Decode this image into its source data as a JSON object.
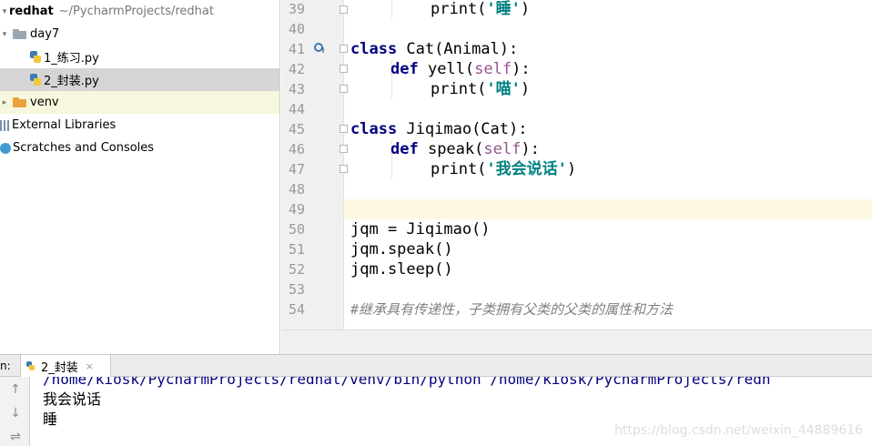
{
  "project_tree": {
    "root_name": "redhat",
    "root_path": "~/PycharmProjects/redhat",
    "folder_day7": "day7",
    "file1": "1_练习.py",
    "file2": "2_封装.py",
    "folder_venv": "venv",
    "external_libraries": "External Libraries",
    "scratches": "Scratches and Consoles"
  },
  "editor": {
    "line_numbers": [
      "39",
      "40",
      "41",
      "42",
      "43",
      "44",
      "45",
      "46",
      "47",
      "48",
      "49",
      "50",
      "51",
      "52",
      "53",
      "54"
    ],
    "current_line": "49",
    "code": {
      "l39_text": "print(",
      "l39_str": "'睡'",
      "l39_close": ")",
      "l41_kw": "class",
      "l41_rest": " Cat(Animal):",
      "l42_kw": "def",
      "l42_name": " yell(",
      "l42_self": "self",
      "l42_end": "):",
      "l43_text": "print(",
      "l43_str": "'喵'",
      "l43_close": ")",
      "l45_kw": "class",
      "l45_rest": " Jiqimao(Cat):",
      "l46_kw": "def",
      "l46_name": " speak(",
      "l46_self": "self",
      "l46_end": "):",
      "l47_text": "print(",
      "l47_str": "'我会说话'",
      "l47_close": ")",
      "l50": "jqm = Jiqimao()",
      "l51": "jqm.speak()",
      "l52": "jqm.sleep()",
      "l54": "#继承具有传递性，子类拥有父类的父类的属性和方法"
    }
  },
  "run_window": {
    "label": "n:",
    "tab_label": "2_封装",
    "close_glyph": "×",
    "up_glyph": "↑",
    "down_glyph": "↓",
    "wrap_glyph": "⇌",
    "output": [
      "/home/kiosk/PycharmProjects/redhat/venv/bin/python /home/kiosk/PycharmProjects/redh",
      "我会说话",
      "睡"
    ],
    "watermark": "https://blog.csdn.net/weixin_44889616"
  },
  "colors": {
    "keyword": "#000080",
    "self": "#94558d",
    "string": "#008080",
    "comment": "#808080",
    "caret_line": "#fdf8e2",
    "venv_row": "#f6f7dc",
    "selected_row": "#d5d5d5"
  },
  "icons": [
    "folder-icon",
    "python-file-icon",
    "library-icon",
    "scratches-icon",
    "breakpoint-override-icon",
    "fold-marker-icon",
    "arrow-up-icon",
    "arrow-down-icon",
    "soft-wrap-icon",
    "close-icon"
  ]
}
